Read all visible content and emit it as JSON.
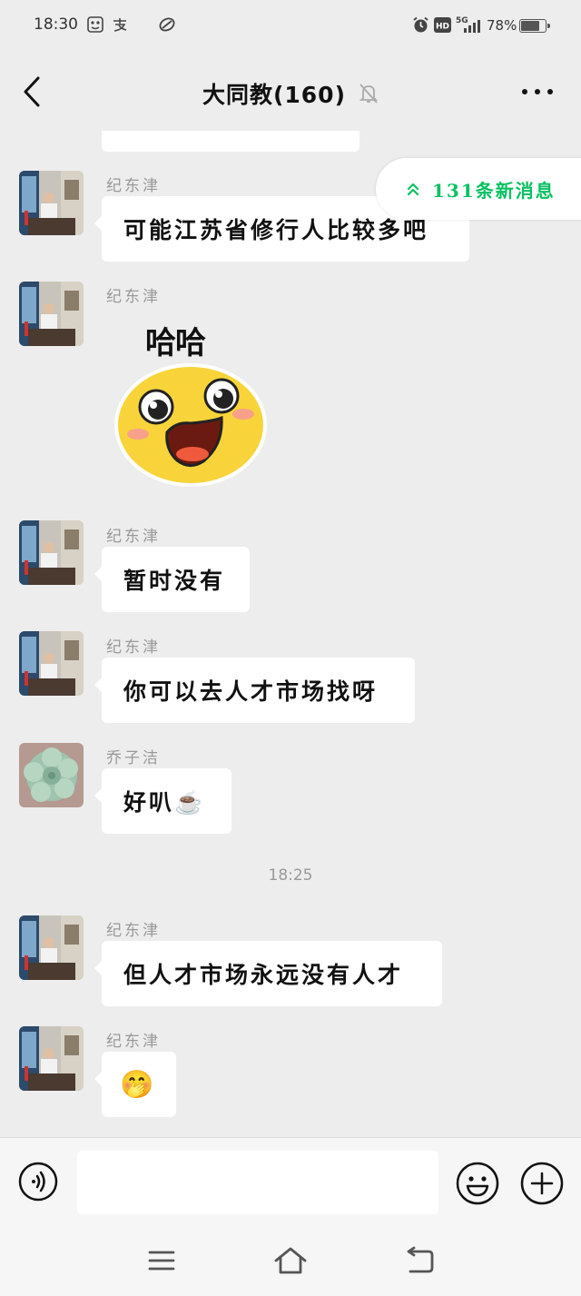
{
  "status": {
    "time": "18:30",
    "battery_pct": "78%",
    "battery_level": 0.78,
    "network": "5G",
    "hd": "HD"
  },
  "header": {
    "title": "大同教(160)"
  },
  "new_messages_label": "131条新消息",
  "messages": [
    {
      "sender": "纪东津",
      "text": "可能江苏省修行人比较多吧"
    },
    {
      "sender": "纪东津",
      "sticker_text": "哈哈"
    },
    {
      "sender": "纪东津",
      "text": "暂时没有"
    },
    {
      "sender": "纪东津",
      "text": "你可以去人才市场找呀"
    },
    {
      "sender": "乔子洁",
      "text": "好叭☕"
    },
    {
      "sender": "纪东津",
      "text": "但人才市场永远没有人才"
    },
    {
      "sender": "纪东津",
      "text": "🤭"
    }
  ],
  "timestamp": "18:25",
  "input": {
    "value": "",
    "placeholder": ""
  },
  "icons": {
    "back": "back-icon",
    "mute": "bell-off-icon",
    "more": "more-icon",
    "voice": "voice-icon",
    "emoji": "emoji-icon",
    "plus": "plus-icon"
  },
  "colors": {
    "background": "#ededed",
    "accent": "#07c160",
    "bubble": "#ffffff"
  }
}
